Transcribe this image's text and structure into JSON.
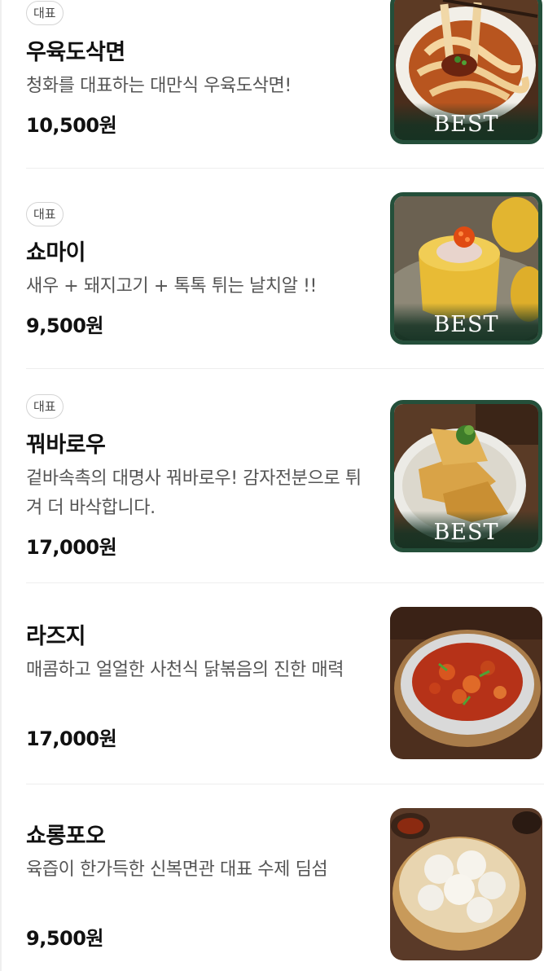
{
  "menu_items": [
    {
      "badge": "대표",
      "name": "우육도삭면",
      "description": "청화를 대표하는 대만식 우육도삭면!",
      "price": "10,500원",
      "image_label": "BEST"
    },
    {
      "badge": "대표",
      "name": "쇼마이",
      "description": "새우 + 돼지고기 + 톡톡 튀는 날치알 !!",
      "price": "9,500원",
      "image_label": "BEST"
    },
    {
      "badge": "대표",
      "name": "꿔바로우",
      "description": "겉바속촉의 대명사 꿔바로우! 감자전분으로 튀겨 더 바삭합니다.",
      "price": "17,000원",
      "image_label": "BEST"
    },
    {
      "name": "라즈지",
      "description": "매콤하고 얼얼한 사천식 닭볶음의 진한 매력",
      "price": "17,000원"
    },
    {
      "name": "쇼롱포오",
      "description": "육즙이 한가득한 신복면관 대표 수제 딤섬",
      "price": "9,500원"
    }
  ],
  "colors": {
    "best_border": "#244f3a",
    "badge_border": "#d4d4d4",
    "price_text": "#111111",
    "desc_text": "#555555"
  }
}
